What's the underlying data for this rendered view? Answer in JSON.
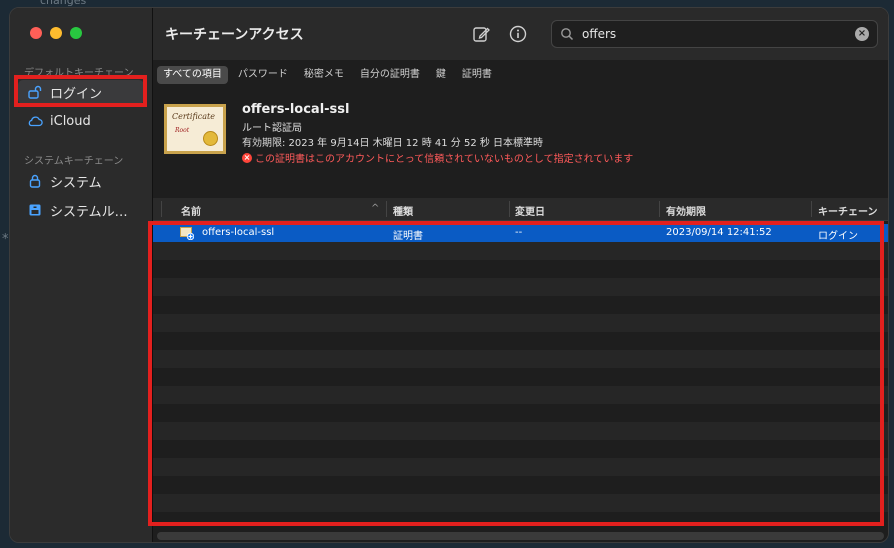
{
  "background": {
    "snippet": "changes",
    "asterisk": "*"
  },
  "window": {
    "title": "キーチェーンアクセス"
  },
  "sidebar": {
    "sections": [
      {
        "label": "デフォルトキーチェーン",
        "items": [
          {
            "label": "ログイン",
            "icon": "lock-open-icon",
            "active": true
          },
          {
            "label": "iCloud",
            "icon": "cloud-icon",
            "active": false
          }
        ]
      },
      {
        "label": "システムキーチェーン",
        "items": [
          {
            "label": "システム",
            "icon": "lock-icon",
            "active": false
          },
          {
            "label": "システムル…",
            "icon": "cabinet-icon",
            "active": false
          }
        ]
      }
    ]
  },
  "toolbar": {
    "compose_icon": "compose-icon",
    "info_icon": "info-icon"
  },
  "search": {
    "value": "offers",
    "placeholder": ""
  },
  "tabs": [
    {
      "label": "すべての項目",
      "active": true
    },
    {
      "label": "パスワード",
      "active": false
    },
    {
      "label": "秘密メモ",
      "active": false
    },
    {
      "label": "自分の証明書",
      "active": false
    },
    {
      "label": "鍵",
      "active": false
    },
    {
      "label": "証明書",
      "active": false
    }
  ],
  "certificate": {
    "image_text": "Certificate",
    "image_sub": "Root",
    "name": "offers-local-ssl",
    "type": "ルート認証局",
    "expiry": "有効期限: 2023 年 9月14日 木曜日 12 時 41 分 52 秒 日本標準時",
    "warning": "この証明書はこのアカウントにとって信頼されていないものとして指定されています"
  },
  "table": {
    "columns": [
      "名前",
      "種類",
      "変更日",
      "有効期限",
      "キーチェーン"
    ],
    "rows": [
      {
        "name": "offers-local-ssl",
        "kind": "証明書",
        "modified": "--",
        "expires": "2023/09/14 12:41:52",
        "keychain": "ログイン",
        "selected": true
      }
    ]
  },
  "colors": {
    "selection": "#0a5bc4",
    "highlight_box": "#e3201e",
    "warning": "#ff5a5a"
  }
}
